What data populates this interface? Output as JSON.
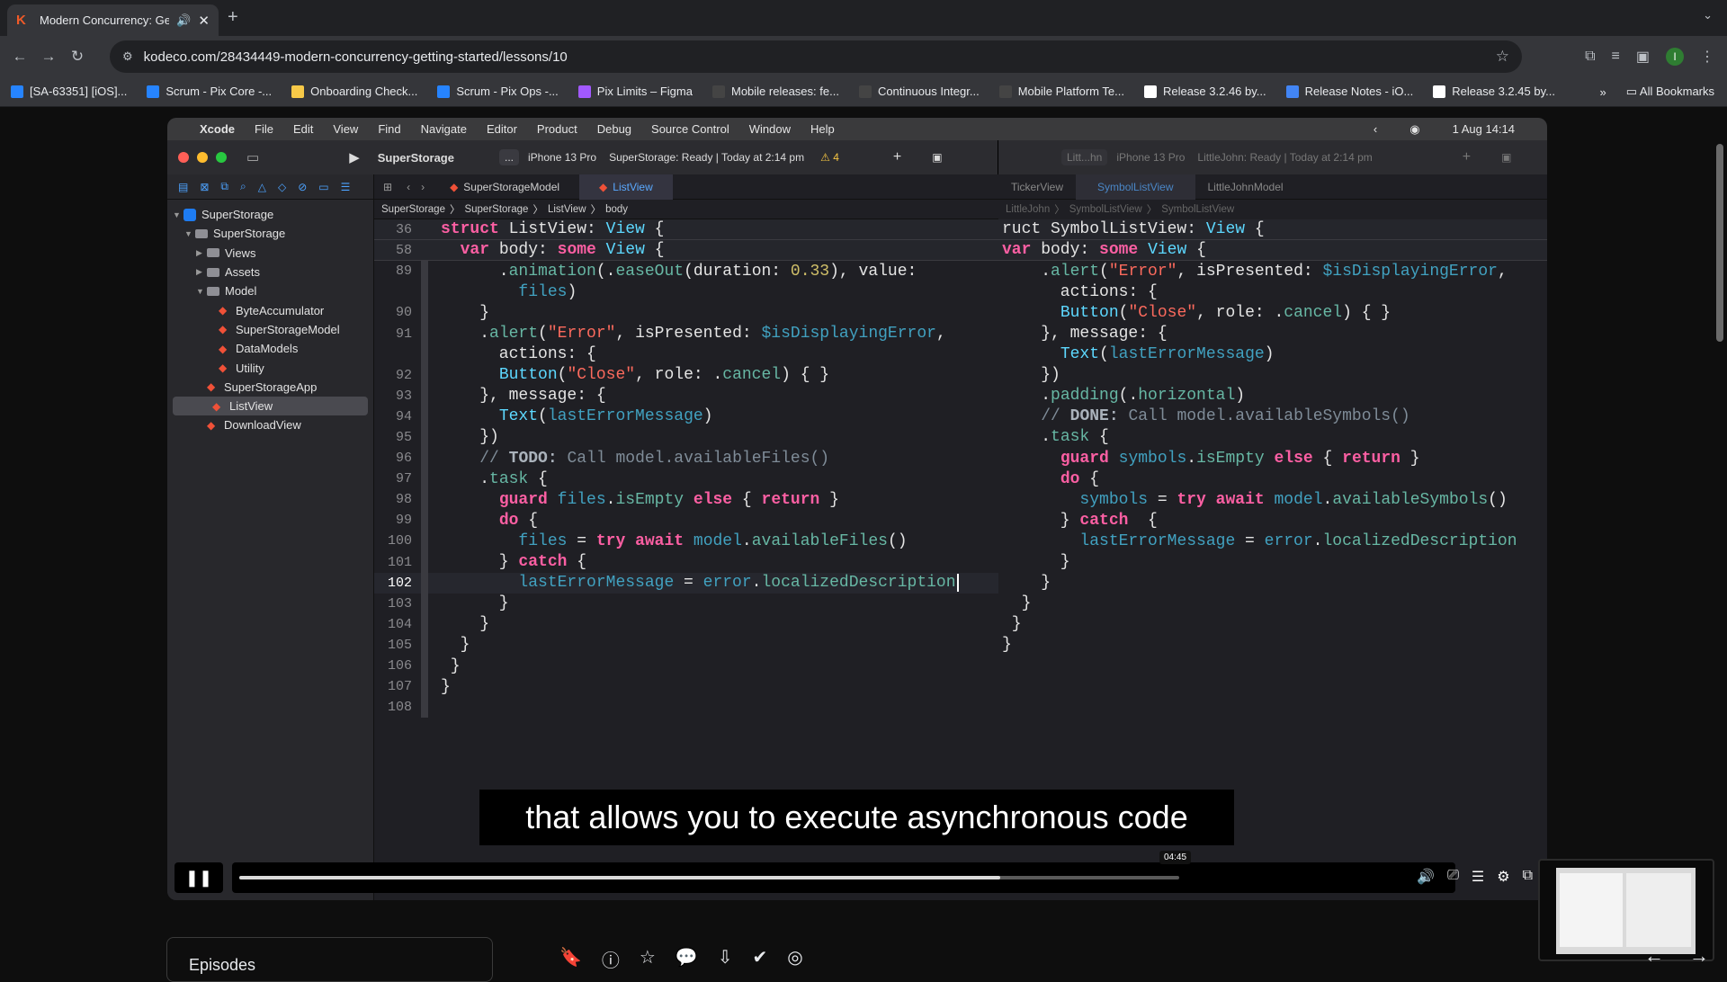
{
  "browser": {
    "tab_title": "Modern Concurrency: Get",
    "url": "kodeco.com/28434449-modern-concurrency-getting-started/lessons/10",
    "bookmarks": [
      {
        "label": "[SA-63351] [iOS]...",
        "color": "#2684ff"
      },
      {
        "label": "Scrum - Pix Core -...",
        "color": "#2684ff"
      },
      {
        "label": "Onboarding Check...",
        "color": "#f7c948"
      },
      {
        "label": "Scrum - Pix Ops -...",
        "color": "#2684ff"
      },
      {
        "label": "Pix Limits – Figma",
        "color": "#a259ff"
      },
      {
        "label": "Mobile releases: fe...",
        "color": "#444"
      },
      {
        "label": "Continuous Integr...",
        "color": "#444"
      },
      {
        "label": "Mobile Platform Te...",
        "color": "#444"
      },
      {
        "label": "Release 3.2.46 by...",
        "color": "#ffffff"
      },
      {
        "label": "Release Notes - iO...",
        "color": "#4285f4"
      },
      {
        "label": "Release 3.2.45 by...",
        "color": "#ffffff"
      }
    ],
    "all_bookmarks": "All Bookmarks",
    "more": "»",
    "avatar": "I"
  },
  "mac_menu": {
    "items": [
      "Xcode",
      "File",
      "Edit",
      "View",
      "Find",
      "Navigate",
      "Editor",
      "Product",
      "Debug",
      "Source Control",
      "Window",
      "Help"
    ],
    "clock": "1 Aug  14:14"
  },
  "left_xcode": {
    "project": "SuperStorage",
    "scheme": "...",
    "device": "iPhone 13 Pro",
    "status": "SuperStorage: Ready | Today at 2:14 pm",
    "warnings": "4",
    "tabs": [
      "SuperStorageModel",
      "ListView"
    ],
    "crumbs": [
      "SuperStorage",
      "SuperStorage",
      "ListView",
      "body"
    ],
    "tree": [
      {
        "label": "SuperStorage",
        "depth": 0,
        "kind": "proj",
        "open": true
      },
      {
        "label": "SuperStorage",
        "depth": 1,
        "kind": "folder",
        "open": true
      },
      {
        "label": "Views",
        "depth": 2,
        "kind": "folder",
        "open": false
      },
      {
        "label": "Assets",
        "depth": 2,
        "kind": "folder",
        "open": false
      },
      {
        "label": "Model",
        "depth": 2,
        "kind": "folder",
        "open": true
      },
      {
        "label": "ByteAccumulator",
        "depth": 3,
        "kind": "swift"
      },
      {
        "label": "SuperStorageModel",
        "depth": 3,
        "kind": "swift"
      },
      {
        "label": "DataModels",
        "depth": 3,
        "kind": "swift"
      },
      {
        "label": "Utility",
        "depth": 3,
        "kind": "swift"
      },
      {
        "label": "SuperStorageApp",
        "depth": 2,
        "kind": "swift"
      },
      {
        "label": "ListView",
        "depth": 2,
        "kind": "swift",
        "selected": true
      },
      {
        "label": "DownloadView",
        "depth": 2,
        "kind": "swift"
      }
    ],
    "sticky": [
      {
        "num": "36",
        "code": "struct ListView: View {"
      },
      {
        "num": "58",
        "code": "  var body: some View {"
      }
    ],
    "lines": [
      {
        "num": "89",
        "code": "      .animation(.easeOut(duration: 0.33), value:"
      },
      {
        "num": "",
        "code": "        files)"
      },
      {
        "num": "90",
        "code": "    }"
      },
      {
        "num": "91",
        "code": "    .alert(\"Error\", isPresented: $isDisplayingError,"
      },
      {
        "num": "",
        "code": "      actions: {"
      },
      {
        "num": "92",
        "code": "      Button(\"Close\", role: .cancel) { }"
      },
      {
        "num": "93",
        "code": "    }, message: {"
      },
      {
        "num": "94",
        "code": "      Text(lastErrorMessage)"
      },
      {
        "num": "95",
        "code": "    })"
      },
      {
        "num": "96",
        "code": "    // TODO: Call model.availableFiles()"
      },
      {
        "num": "97",
        "code": "    .task {"
      },
      {
        "num": "98",
        "code": "      guard files.isEmpty else { return }"
      },
      {
        "num": "99",
        "code": "      do {"
      },
      {
        "num": "100",
        "code": "        files = try await model.availableFiles()"
      },
      {
        "num": "101",
        "code": "      } catch {"
      },
      {
        "num": "102",
        "code": "        lastErrorMessage = error.localizedDescription"
      },
      {
        "num": "103",
        "code": "      }"
      },
      {
        "num": "104",
        "code": "    }"
      },
      {
        "num": "105",
        "code": "  }"
      },
      {
        "num": "106",
        "code": " }"
      },
      {
        "num": "107",
        "code": "}"
      },
      {
        "num": "108",
        "code": ""
      }
    ]
  },
  "right_xcode": {
    "scheme": "Litt...hn",
    "device": "iPhone 13 Pro",
    "status": "LittleJohn: Ready | Today at 2:14 pm",
    "tabs": [
      "TickerView",
      "SymbolListView",
      "LittleJohnModel"
    ],
    "crumbs": [
      "LittleJohn",
      "SymbolListView",
      "SymbolListView"
    ],
    "sticky": [
      "ruct SymbolListView: View {",
      "var body: some View {"
    ],
    "lines": [
      "    .alert(\"Error\", isPresented: $isDisplayingError,",
      "      actions: {",
      "      Button(\"Close\", role: .cancel) { }",
      "    }, message: {",
      "      Text(lastErrorMessage)",
      "    })",
      "    .padding(.horizontal)",
      "    // DONE: Call model.availableSymbols()",
      "    .task {",
      "      guard symbols.isEmpty else { return }",
      "      do {",
      "        symbols = try await model.availableSymbols()",
      "      } catch  {",
      "        lastErrorMessage = error.localizedDescription",
      "      }",
      "    }",
      "  }",
      " }",
      "}"
    ]
  },
  "player": {
    "caption": "that allows you to execute asynchronous code",
    "time": "04:45",
    "progress": 0.81
  },
  "page": {
    "episodes": "Episodes"
  }
}
